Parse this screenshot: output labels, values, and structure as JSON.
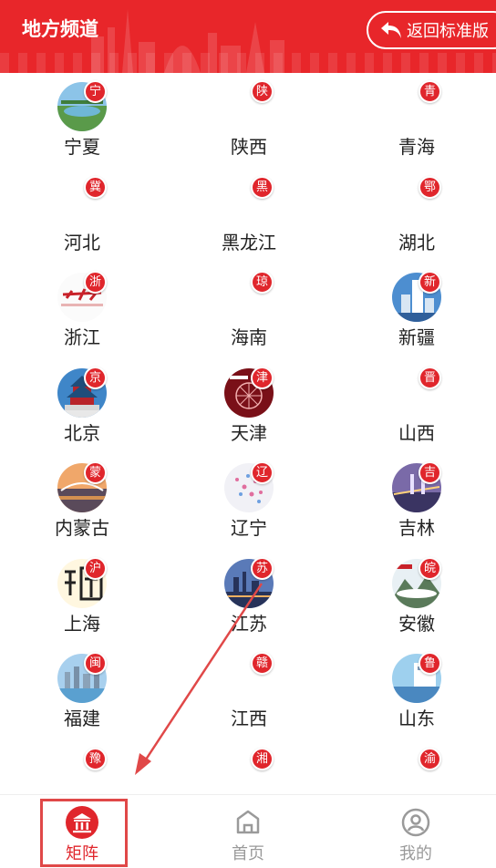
{
  "header": {
    "title": "地方频道",
    "back_button_label": "返回标准版",
    "back_icon": "return-arrow-icon"
  },
  "provinces": [
    {
      "name": "宁夏",
      "abbr": "宁",
      "thumbnail": "lake-park"
    },
    {
      "name": "陕西",
      "abbr": "陕",
      "thumbnail": ""
    },
    {
      "name": "青海",
      "abbr": "青",
      "thumbnail": ""
    },
    {
      "name": "河北",
      "abbr": "冀",
      "thumbnail": ""
    },
    {
      "name": "黑龙江",
      "abbr": "黑",
      "thumbnail": ""
    },
    {
      "name": "湖北",
      "abbr": "鄂",
      "thumbnail": ""
    },
    {
      "name": "浙江",
      "abbr": "浙",
      "thumbnail": "calligraphy-logo"
    },
    {
      "name": "海南",
      "abbr": "琼",
      "thumbnail": ""
    },
    {
      "name": "新疆",
      "abbr": "新",
      "thumbnail": "city-tower"
    },
    {
      "name": "北京",
      "abbr": "京",
      "thumbnail": "temple-of-heaven"
    },
    {
      "name": "天津",
      "abbr": "津",
      "thumbnail": "ferris-wheel-night"
    },
    {
      "name": "山西",
      "abbr": "晋",
      "thumbnail": ""
    },
    {
      "name": "内蒙古",
      "abbr": "蒙",
      "thumbnail": "bridge-sunset"
    },
    {
      "name": "辽宁",
      "abbr": "辽",
      "thumbnail": "map-dots"
    },
    {
      "name": "吉林",
      "abbr": "吉",
      "thumbnail": "bridge-night"
    },
    {
      "name": "上海",
      "abbr": "沪",
      "thumbnail": "seal-calligraphy"
    },
    {
      "name": "江苏",
      "abbr": "苏",
      "thumbnail": "skyline-dusk"
    },
    {
      "name": "安徽",
      "abbr": "皖",
      "thumbnail": "mountain-clouds"
    },
    {
      "name": "福建",
      "abbr": "闽",
      "thumbnail": "coastal-city"
    },
    {
      "name": "江西",
      "abbr": "赣",
      "thumbnail": ""
    },
    {
      "name": "山东",
      "abbr": "鲁",
      "thumbnail": "seaside-town"
    },
    {
      "name": "",
      "abbr": "豫",
      "thumbnail": ""
    },
    {
      "name": "",
      "abbr": "湘",
      "thumbnail": ""
    },
    {
      "name": "",
      "abbr": "渝",
      "thumbnail": ""
    }
  ],
  "tabbar": {
    "tabs": [
      {
        "label": "矩阵",
        "icon": "bank-building-icon",
        "active": true
      },
      {
        "label": "首页",
        "icon": "home-icon",
        "active": false
      },
      {
        "label": "我的",
        "icon": "user-profile-icon",
        "active": false
      }
    ]
  },
  "colors": {
    "brand_red": "#e8262a",
    "badge_red": "#e0262c",
    "annotation_red": "#e04848",
    "inactive_gray": "#9a9a9a"
  }
}
